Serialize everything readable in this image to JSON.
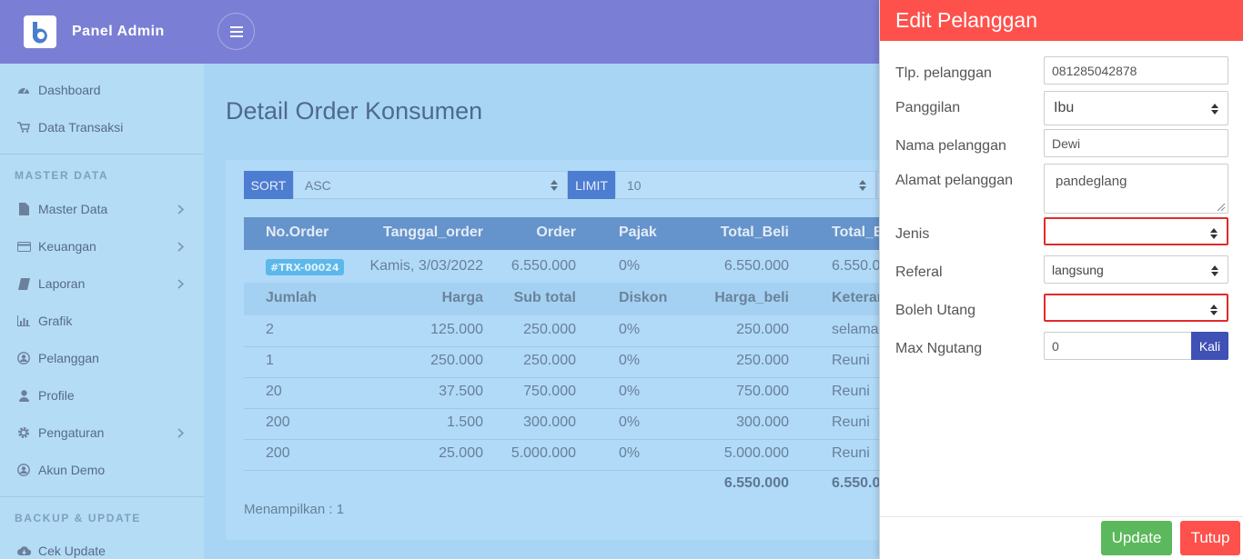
{
  "brand": {
    "name": "Panel Admin"
  },
  "sidebar": {
    "items": [
      {
        "label": "Dashboard",
        "icon": "dashboard-icon"
      },
      {
        "label": "Data Transaksi",
        "icon": "cart-icon"
      }
    ],
    "master_title": "MASTER DATA",
    "master_items": [
      {
        "label": "Master Data",
        "icon": "file-icon"
      },
      {
        "label": "Keuangan",
        "icon": "credit-card-icon"
      },
      {
        "label": "Laporan",
        "icon": "book-icon"
      },
      {
        "label": "Grafik",
        "icon": "bar-chart-icon"
      },
      {
        "label": "Pelanggan",
        "icon": "user-circle-icon"
      },
      {
        "label": "Profile",
        "icon": "user-icon"
      },
      {
        "label": "Pengaturan",
        "icon": "gear-icon"
      },
      {
        "label": "Akun Demo",
        "icon": "user-circle-icon"
      }
    ],
    "backup_title": "BACKUP & UPDATE",
    "backup_items": [
      {
        "label": "Cek Update",
        "icon": "cloud-download-icon"
      }
    ]
  },
  "main": {
    "title": "Detail Order Konsumen",
    "sort_label": "SORT",
    "sort_value": "ASC",
    "limit_label": "LIMIT",
    "limit_value": "10",
    "table": {
      "headers": [
        "No.Order",
        "Tanggal_order",
        "Order",
        "Pajak",
        "Total_Beli",
        "Total_B"
      ],
      "order": {
        "id": "#TRX-00024",
        "date": "Kamis, 3/03/2022",
        "order": "6.550.000",
        "pajak": "0%",
        "total_beli": "6.550.000",
        "total_b": "6.550.0"
      },
      "subheaders": [
        "Jumlah",
        "Harga",
        "Sub total",
        "Diskon",
        "Harga_beli",
        "Keteran"
      ],
      "rows": [
        [
          "2",
          "125.000",
          "250.000",
          "0%",
          "250.000",
          "selamat"
        ],
        [
          "1",
          "250.000",
          "250.000",
          "0%",
          "250.000",
          "Reuni"
        ],
        [
          "20",
          "37.500",
          "750.000",
          "0%",
          "750.000",
          "Reuni"
        ],
        [
          "200",
          "1.500",
          "300.000",
          "0%",
          "300.000",
          "Reuni"
        ],
        [
          "200",
          "25.000",
          "5.000.000",
          "0%",
          "5.000.000",
          "Reuni"
        ]
      ],
      "total_harga_beli": "6.550.000",
      "total_last": "6.550.0"
    },
    "showing": "Menampilkan : 1"
  },
  "modal": {
    "title": "Edit Pelanggan",
    "fields": {
      "phone_label": "Tlp. pelanggan",
      "phone_value": "081285042878",
      "salutation_label": "Panggilan",
      "salutation_value": "Ibu",
      "name_label": "Nama pelanggan",
      "name_value": "Dewi",
      "address_label": "Alamat pelanggan",
      "address_value": "pandeglang",
      "type_label": "Jenis",
      "type_value": "",
      "referral_label": "Referal",
      "referral_value": "langsung",
      "debt_label": "Boleh Utang",
      "debt_value": "",
      "maxdebt_label": "Max Ngutang",
      "maxdebt_value": "0",
      "maxdebt_addon": "Kali"
    },
    "update_label": "Update",
    "close_label": "Tutup"
  },
  "colors": {
    "navbar": "#7a7fd5",
    "sidebar": "#b4dcf5",
    "modal_header": "#fe514c",
    "update_button": "#5cb85c",
    "addon": "#3f51b5",
    "invalid_border": "#e02b2b"
  }
}
